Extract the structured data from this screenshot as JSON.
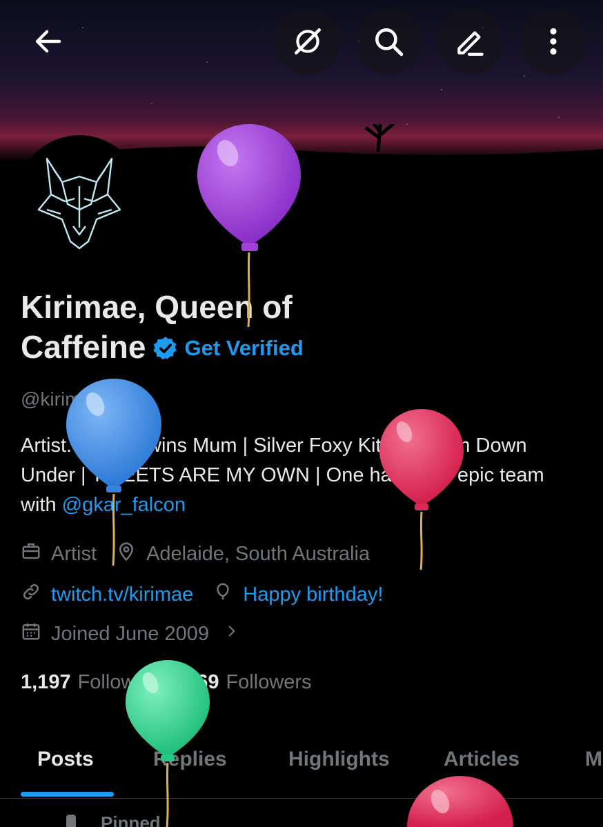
{
  "header": {
    "back_icon": "arrow-left-icon",
    "actions": [
      "grok-icon",
      "search-icon",
      "edit-icon",
      "more-vertical-icon"
    ]
  },
  "profile": {
    "name_line1": "Kirimae, Queen of",
    "name_line2": "Caffeine",
    "verified_icon": "verified-badge-icon",
    "get_verified": "Get Verified",
    "handle": "@kirimae",
    "bio": {
      "p1": "Artist. ",
      "flag": "🇦🇺",
      "p2": " 1+ Twins Mum | Silver Foxy Kitsune from Down Under | TWEETS ARE MY OWN |  One half of an epic team with ",
      "mention": "@gkar_falcon"
    },
    "profession": "Artist",
    "location": "Adelaide, South Australia",
    "website": "twitch.tv/kirimae",
    "birthday": "Happy birthday!",
    "joined": "Joined June 2009",
    "following_count": "1,197",
    "following_label": "Following",
    "followers_count": "569",
    "followers_label": "Followers"
  },
  "tabs": [
    "Posts",
    "Replies",
    "Highlights",
    "Articles",
    "M"
  ],
  "pinned_label": "Pinned",
  "colors": {
    "accent": "#1d9bf0",
    "background": "#000000",
    "muted": "#71767b",
    "balloon_purple": "#9b3fd6",
    "balloon_blue": "#3c8ee6",
    "balloon_red": "#e0305a",
    "balloon_green": "#2fd68e"
  }
}
